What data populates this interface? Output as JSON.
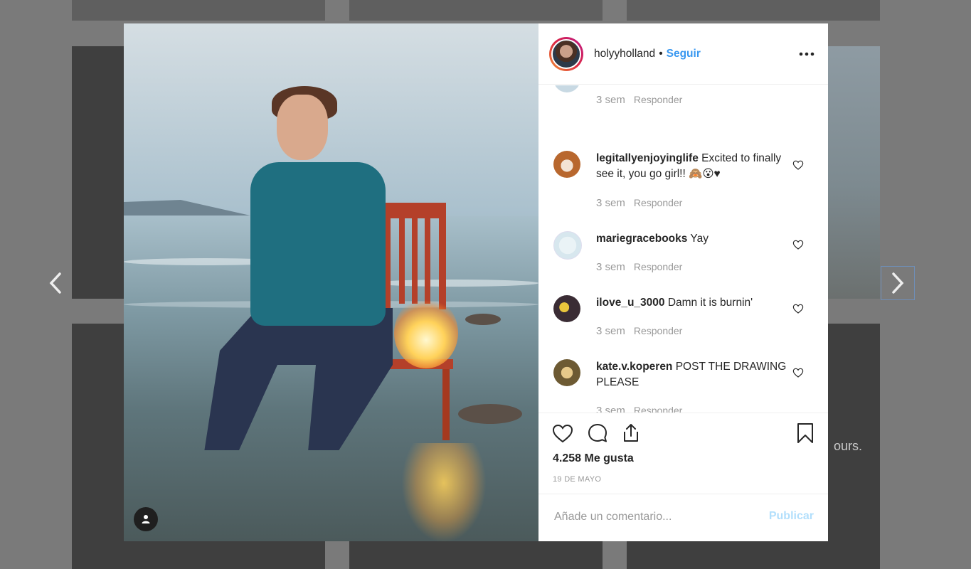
{
  "post": {
    "username": "holyyholland",
    "follow_label": "Seguir",
    "likes": "4.258 Me gusta",
    "date": "19 DE MAYO"
  },
  "comments": [
    {
      "username": "",
      "text": "",
      "time": "3 sem",
      "reply": "Responder"
    },
    {
      "username": "legitallyenjoyinglife",
      "text": "Excited to finally see it, you go girl!! 🙈😮♥",
      "time": "3 sem",
      "reply": "Responder"
    },
    {
      "username": "mariegracebooks",
      "text": "Yay",
      "time": "3 sem",
      "reply": "Responder"
    },
    {
      "username": "ilove_u_3000",
      "text": "Damn it is burnin'",
      "time": "3 sem",
      "reply": "Responder"
    },
    {
      "username": "kate.v.koperen",
      "text": "POST THE DRAWING PLEASE",
      "time": "3 sem",
      "reply": "Responder"
    }
  ],
  "comment_box": {
    "placeholder": "Añade un comentario...",
    "post_label": "Publicar"
  },
  "background": {
    "caption": "ours."
  },
  "colors": {
    "accent": "#3897f0",
    "post_disabled": "#b2dffc",
    "overlay": "#7a7a7a"
  },
  "icons": [
    "user-tag-icon",
    "more-options-icon",
    "heart-icon",
    "comment-icon",
    "share-icon",
    "bookmark-icon",
    "chevron-left-icon",
    "chevron-right-icon"
  ]
}
